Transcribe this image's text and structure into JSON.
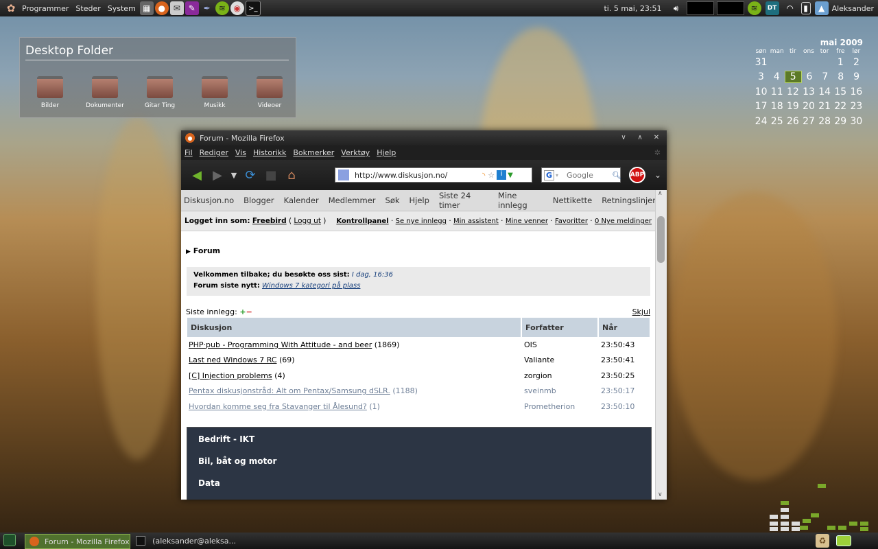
{
  "top_panel": {
    "menus": [
      "Programmer",
      "Steder",
      "System"
    ],
    "clock": "ti.  5 mai, 23:51",
    "user": "Aleksander"
  },
  "desktop_folder": {
    "title": "Desktop Folder",
    "items": [
      "Bilder",
      "Dokumenter",
      "Gitar Ting",
      "Musikk",
      "Videoer"
    ]
  },
  "calendar": {
    "month": "mai 2009",
    "weekdays": [
      "søn",
      "man",
      "tir",
      "ons",
      "tor",
      "fre",
      "lør"
    ],
    "rows": [
      [
        "31",
        "",
        "",
        "",
        "",
        "1",
        "2"
      ],
      [
        "3",
        "4",
        "5",
        "6",
        "7",
        "8",
        "9"
      ],
      [
        "10",
        "11",
        "12",
        "13",
        "14",
        "15",
        "16"
      ],
      [
        "17",
        "18",
        "19",
        "20",
        "21",
        "22",
        "23"
      ],
      [
        "24",
        "25",
        "26",
        "27",
        "28",
        "29",
        "30"
      ]
    ],
    "today": "5"
  },
  "firefox": {
    "title": "Forum - Mozilla Firefox",
    "menu": [
      "Fil",
      "Rediger",
      "Vis",
      "Historikk",
      "Bokmerker",
      "Verktøy",
      "Hjelp"
    ],
    "url": "http://www.diskusjon.no/",
    "search_placeholder": "Google",
    "abp_label": "ABP"
  },
  "site": {
    "nav": [
      "Diskusjon.no",
      "Blogger",
      "Kalender",
      "Medlemmer",
      "Søk",
      "Hjelp",
      "Siste 24 timer",
      "Mine innlegg",
      "Nettikette",
      "Retningslinjer"
    ],
    "logged_in_label": "Logget inn som:",
    "username": "Freebird",
    "logout": "Logg ut",
    "links": [
      "Kontrollpanel",
      "Se nye innlegg",
      "Min assistent",
      "Mine venner",
      "Favoritter",
      "0 Nye meldinger"
    ],
    "forum_heading": "Forum",
    "welcome_label": "Velkommen tilbake; du besøkte oss sist:",
    "last_visit": "I dag, 16:36",
    "news_label": "Forum siste nytt:",
    "news_link": "Windows 7 kategori på plass",
    "recent_label": "Siste innlegg:",
    "hide": "Skjul",
    "columns": [
      "Diskusjon",
      "Forfatter",
      "Når"
    ],
    "posts": [
      {
        "title": "PHP·pub - Programming With Attitude - and beer",
        "count": "(1869)",
        "author": "OIS",
        "time": "23:50:43"
      },
      {
        "title": "Last ned Windows 7 RC",
        "count": "(69)",
        "author": "Valiante",
        "time": "23:50:41"
      },
      {
        "title": "[C] Injection problems",
        "count": "(4)",
        "author": "zorgion",
        "time": "23:50:25"
      },
      {
        "title": "Pentax diskusjonstråd: Alt om Pentax/Samsung dSLR.",
        "count": "(1188)",
        "author": "sveinmb",
        "time": "23:50:17"
      },
      {
        "title": "Hvordan komme seg fra Stavanger til Ålesund?",
        "count": "(1)",
        "author": "Prometherion",
        "time": "23:50:10"
      }
    ],
    "categories": [
      "Bedrift - IKT",
      "Bil, båt og motor",
      "Data"
    ]
  },
  "taskbar": {
    "tasks": [
      "Forum - Mozilla Firefox",
      "(aleksander@aleksa..."
    ]
  }
}
